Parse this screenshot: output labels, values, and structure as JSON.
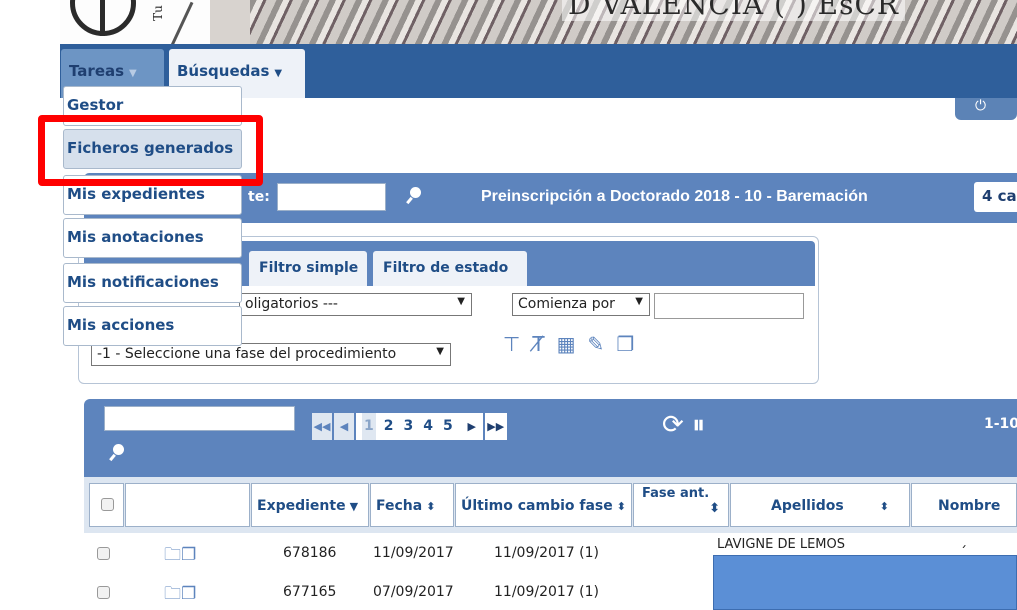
{
  "banner": {
    "university_text": "D VALENCIA (    ) EsCR",
    "logo_side_text": "Tu"
  },
  "nav": {
    "tabs": [
      {
        "label": "Tareas",
        "caret": "▼"
      },
      {
        "label": "Búsquedas",
        "caret": "▼"
      }
    ],
    "power_icon": "⏻"
  },
  "menu": {
    "items": [
      "Gestor",
      "Ficheros generados",
      "Mis expedientes",
      "Mis anotaciones",
      "Mis notificaciones",
      "Mis acciones"
    ],
    "active_index": 1,
    "highlight_color": "#ff0000"
  },
  "titlebar": {
    "field_label": "te:",
    "field_value": "",
    "title": "Preinscripción a Doctorado 2018 - 10 - Baremación",
    "count": "4 ca"
  },
  "filter": {
    "tabs": [
      "Filtro simple",
      "Filtro de estado"
    ],
    "obligatorios_select": "oligatorios ---",
    "comienza_select": "Comienza por",
    "text_value": "",
    "fase_select": "-1 - Seleccione una fase del procedimiento",
    "icons": [
      "funnel-icon",
      "clear-filter-icon",
      "excel-icon",
      "edit-icon",
      "copy-icon"
    ]
  },
  "grid": {
    "search_value": "",
    "pager": {
      "first": "◀◀",
      "prev": "◀",
      "pages": [
        "1",
        "2",
        "3",
        "4",
        "5"
      ],
      "current": "1",
      "next": "▶",
      "last": "▶▶"
    },
    "range": "1-10",
    "columns": [
      {
        "label": "",
        "sort": ""
      },
      {
        "label": "",
        "sort": ""
      },
      {
        "label": "Expediente",
        "sort": "▼"
      },
      {
        "label": "Fecha",
        "sort": "⬍"
      },
      {
        "label": "Último cambio fase",
        "sort": "⬍"
      },
      {
        "label": "Fase ant.",
        "sort": "⬍"
      },
      {
        "label": "Apellidos",
        "sort": "⬍"
      },
      {
        "label": "Nombre",
        "sort": ""
      }
    ],
    "rows": [
      {
        "expediente": "678186",
        "fecha": "11/09/2017",
        "cambio": "11/09/2017 (1)",
        "apellidos": "LAVIGNE DE LEMOS",
        "nombre": "´"
      },
      {
        "expediente": "677165",
        "fecha": "07/09/2017",
        "cambio": "11/09/2017 (1)",
        "apellidos": "",
        "nombre": ""
      }
    ]
  }
}
